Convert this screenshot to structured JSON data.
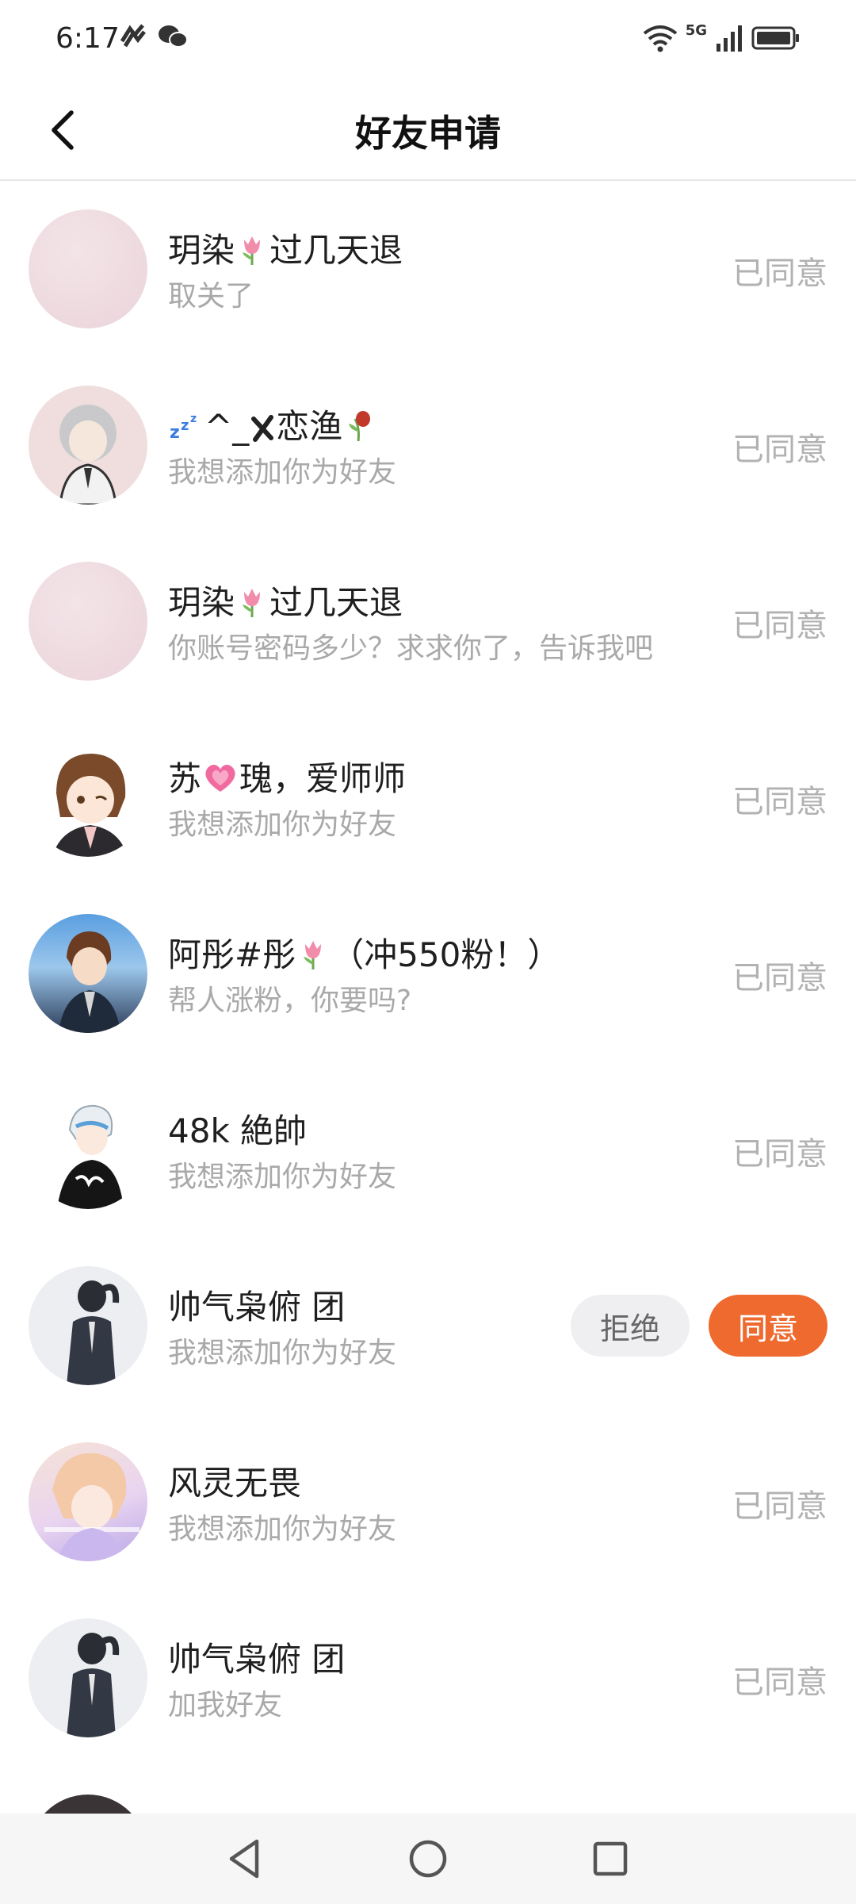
{
  "status_bar": {
    "time": "6:17",
    "network": "5G"
  },
  "header": {
    "title": "好友申请"
  },
  "colors": {
    "accent": "#ee6a2f",
    "muted": "#b2b2b2"
  },
  "requests": [
    {
      "name_a": "玥染",
      "name_icon": "tulip-icon",
      "name_b": "过几天退",
      "message": "取关了",
      "status": "已同意"
    },
    {
      "name_a": "^_",
      "name_icon": "sleep-zzz-icon",
      "name_b": "恋渔",
      "message": "我想添加你为好友",
      "status": "已同意"
    },
    {
      "name_a": "玥染",
      "name_icon": "tulip-icon",
      "name_b": "过几天退",
      "message": "你账号密码多少？求求你了，告诉我吧",
      "status": "已同意"
    },
    {
      "name_a": "苏",
      "name_icon": "heart-icon",
      "name_b": "瑰，爱师师",
      "message": "我想添加你为好友",
      "status": "已同意"
    },
    {
      "name_a": "阿彤#彤",
      "name_icon": "tulip-icon",
      "name_b": "（冲550粉！）",
      "message": "帮人涨粉，你要吗?",
      "status": "已同意"
    },
    {
      "name": "48k 絶帥",
      "message": "我想添加你为好友",
      "status": "已同意"
    },
    {
      "name": "帅气枭俯 团",
      "message": "我想添加你为好友",
      "reject_label": "拒绝",
      "accept_label": "同意"
    },
    {
      "name": "风灵无畏",
      "message": "我想添加你为好友",
      "status": "已同意"
    },
    {
      "name": "帅气枭俯 团",
      "message": "加我好友",
      "status": "已同意"
    }
  ]
}
